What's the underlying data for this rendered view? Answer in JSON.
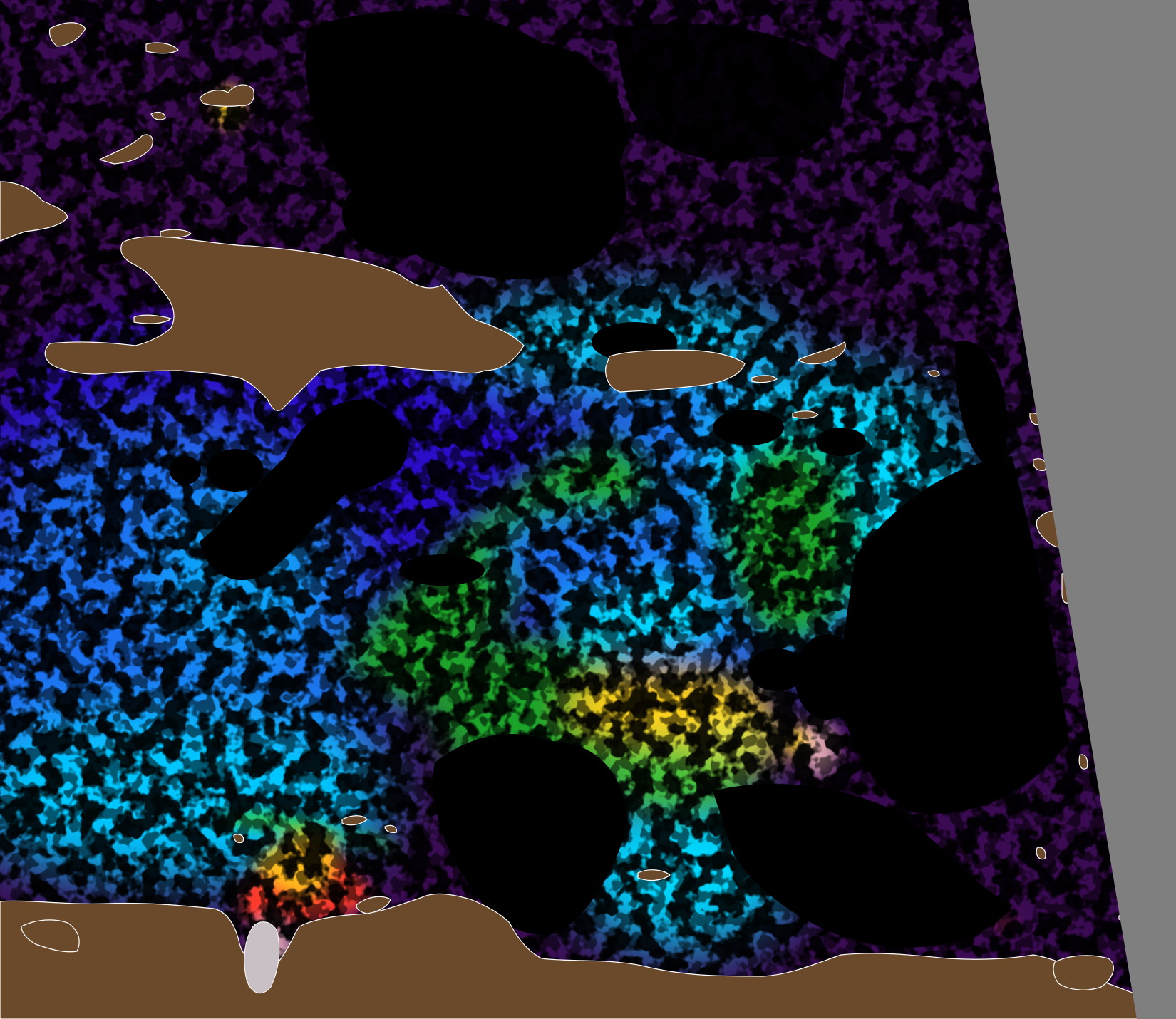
{
  "map": {
    "kind": "satellite ocean-color composite",
    "colors": {
      "cloud_mask": "#000000",
      "land": "#6b4a2b",
      "coastline": "#ffffff",
      "no_data_swath": "#7f7f7f",
      "very_low": "#3a0b52",
      "low": "#2a10c8",
      "low_mid": "#1e6ff0",
      "mid": "#00d8ff",
      "mid_high": "#1fa42a",
      "high": "#ffd21a",
      "very_high": "#ff3b2a",
      "saturated": "#d8a0b0"
    },
    "legend": [],
    "labels": []
  }
}
